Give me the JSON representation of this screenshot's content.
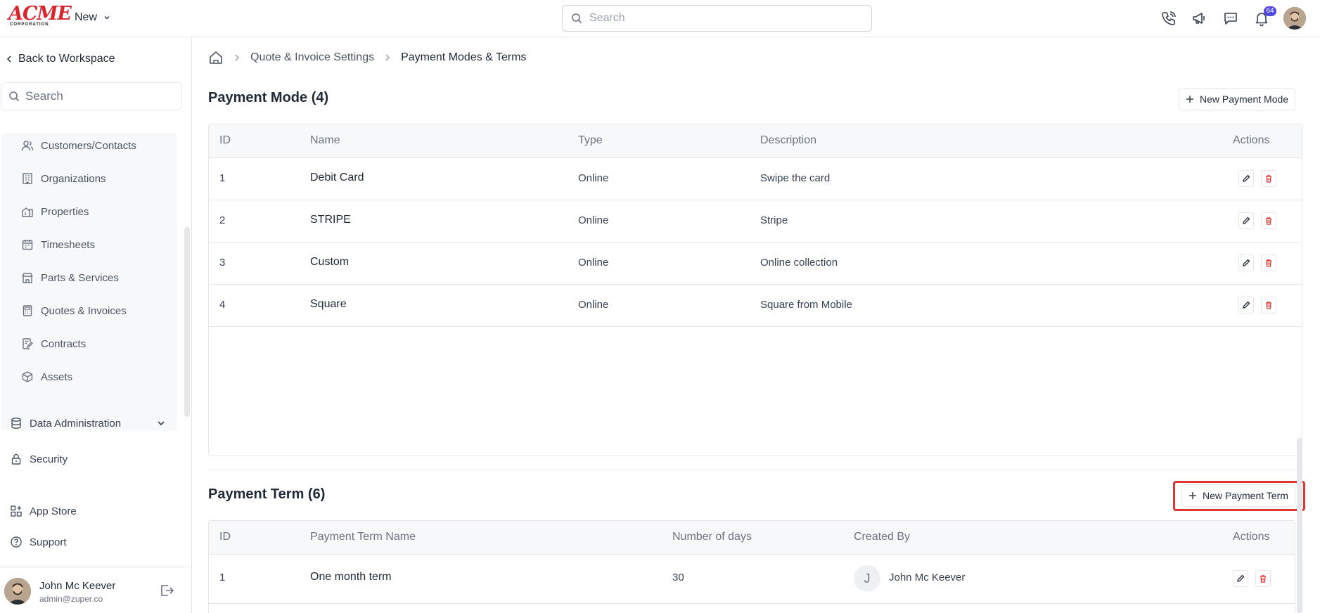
{
  "topbar": {
    "logo_text": "ACME",
    "logo_sub": "CORPORATION",
    "new_label": "New",
    "search_placeholder": "Search",
    "notification_count": "64"
  },
  "sidebar": {
    "back_label": "Back to Workspace",
    "search_placeholder": "Search",
    "items": [
      {
        "label": "Customers/Contacts",
        "icon": "users-icon"
      },
      {
        "label": "Organizations",
        "icon": "building-icon"
      },
      {
        "label": "Properties",
        "icon": "property-icon"
      },
      {
        "label": "Timesheets",
        "icon": "calendar-icon"
      },
      {
        "label": "Parts & Services",
        "icon": "store-icon"
      },
      {
        "label": "Quotes & Invoices",
        "icon": "calculator-icon"
      },
      {
        "label": "Contracts",
        "icon": "contract-icon"
      },
      {
        "label": "Assets",
        "icon": "cube-icon"
      }
    ],
    "data_admin_label": "Data Administration",
    "security_label": "Security",
    "app_store_label": "App Store",
    "support_label": "Support",
    "user": {
      "name": "John Mc Keever",
      "email": "admin@zuper.co"
    }
  },
  "breadcrumb": {
    "parent": "Quote & Invoice Settings",
    "current": "Payment Modes & Terms"
  },
  "payment_mode": {
    "title": "Payment Mode (4)",
    "new_button": "New Payment Mode",
    "columns": {
      "id": "ID",
      "name": "Name",
      "type": "Type",
      "description": "Description",
      "actions": "Actions"
    },
    "rows": [
      {
        "id": "1",
        "name": "Debit Card",
        "type": "Online",
        "description": "Swipe the card"
      },
      {
        "id": "2",
        "name": "STRIPE",
        "type": "Online",
        "description": "Stripe"
      },
      {
        "id": "3",
        "name": "Custom",
        "type": "Online",
        "description": "Online collection"
      },
      {
        "id": "4",
        "name": "Square",
        "type": "Online",
        "description": "Square from Mobile"
      }
    ]
  },
  "payment_term": {
    "title": "Payment Term (6)",
    "new_button": "New Payment Term",
    "columns": {
      "id": "ID",
      "name": "Payment Term Name",
      "days": "Number of days",
      "created_by": "Created By",
      "actions": "Actions"
    },
    "rows": [
      {
        "id": "1",
        "name": "One month term",
        "days": "30",
        "created_by": "John Mc Keever",
        "avatar_initial": "J"
      }
    ]
  },
  "colors": {
    "accent_red": "#d9262e",
    "delete_red": "#e03535",
    "badge": "#4f46e5"
  }
}
